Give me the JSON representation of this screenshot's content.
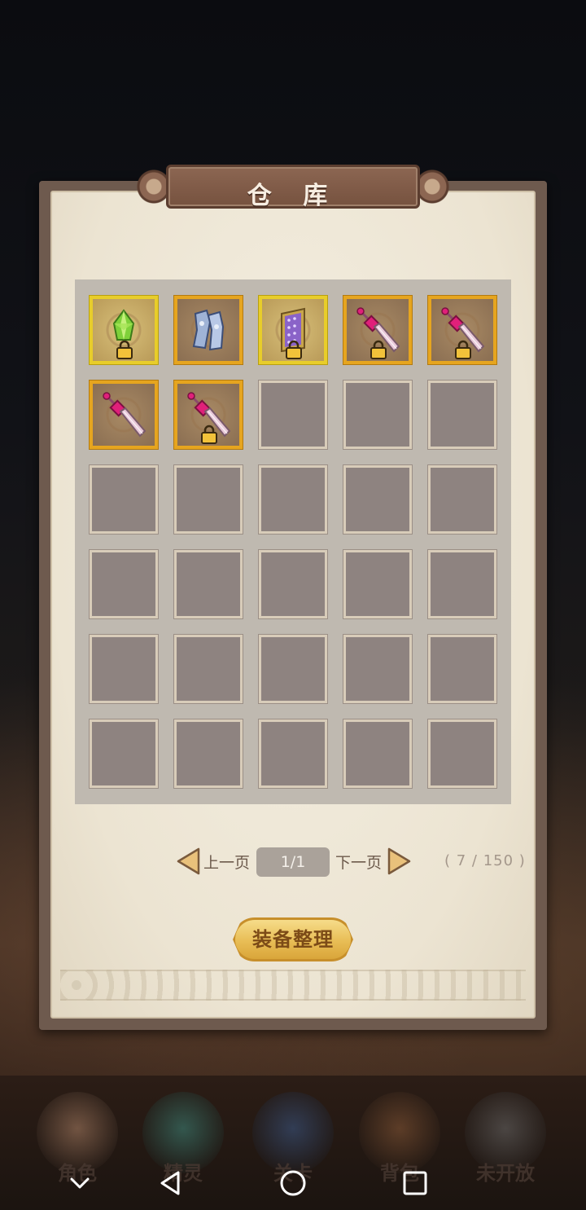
{
  "title": "仓 库",
  "inventory": {
    "items": [
      {
        "name": "green-crystal-icon",
        "frame": "gold",
        "locked": true
      },
      {
        "name": "steel-armor-icon",
        "frame": "orange",
        "locked": false
      },
      {
        "name": "purple-shield-icon",
        "frame": "gold",
        "locked": true
      },
      {
        "name": "pink-sword-icon",
        "frame": "orange",
        "locked": true
      },
      {
        "name": "pink-sword-icon",
        "frame": "orange",
        "locked": true
      },
      {
        "name": "pink-sword-icon",
        "frame": "orange",
        "locked": false
      },
      {
        "name": "pink-sword-icon",
        "frame": "orange",
        "locked": true
      }
    ],
    "total_slots": 30
  },
  "pager": {
    "prev_label": "上一页",
    "next_label": "下一页",
    "page": "1/1",
    "capacity": "( 7 / 150 )"
  },
  "sort_button": "装备整理",
  "bottom_nav": [
    {
      "label": "角色",
      "icon": "character-icon",
      "color": "#b08468"
    },
    {
      "label": "精灵",
      "icon": "spirit-icon",
      "color": "#3f8a7e"
    },
    {
      "label": "关卡",
      "icon": "battle-icon",
      "color": "#3c5a8a"
    },
    {
      "label": "背包",
      "icon": "backpack-icon",
      "color": "#8a5a38"
    },
    {
      "label": "未开放",
      "icon": "locked-shield-icon",
      "color": "#6a6a6a"
    }
  ],
  "system_bar": [
    "hide-keyboard-icon",
    "back-icon",
    "home-icon",
    "recents-icon"
  ],
  "colors": {
    "slot_empty": "#8e8380",
    "frame_orange": "#e6a51f",
    "frame_gold": "#e8cd2a",
    "button_gold": "#e8bd55"
  }
}
